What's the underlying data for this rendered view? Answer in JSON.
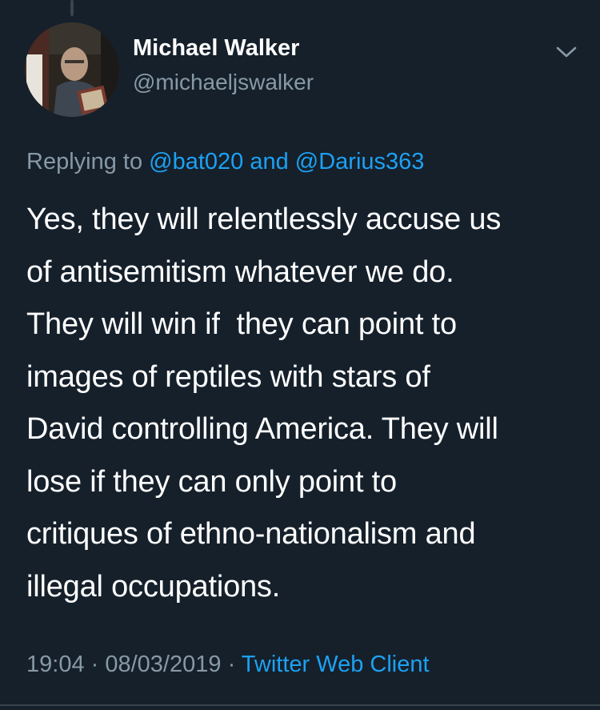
{
  "user": {
    "display_name": "Michael Walker",
    "handle": "@michaeljswalker"
  },
  "reply": {
    "prefix": "Replying to ",
    "mention_1": "@bat020",
    "conjunction": " and ",
    "mention_2": "@Darius363"
  },
  "tweet": {
    "lines": [
      "Yes, they will relentlessly accuse us",
      "of antisemitism whatever we do.",
      "They will win if  they can point to",
      "images of reptiles with stars of",
      "David controlling America. They will",
      "lose if they can only point to",
      "critiques of ethno-nationalism and",
      "illegal occupations."
    ]
  },
  "meta": {
    "time": "19:04",
    "separator_1": " · ",
    "date": "08/03/2019",
    "separator_2": " · ",
    "client": "Twitter Web Client"
  },
  "icons": {
    "more": "chevron-down-icon"
  },
  "colors": {
    "background": "#15202b",
    "text": "#ffffff",
    "muted": "#8899a6",
    "accent": "#1da1f2",
    "divider": "#38444d"
  }
}
